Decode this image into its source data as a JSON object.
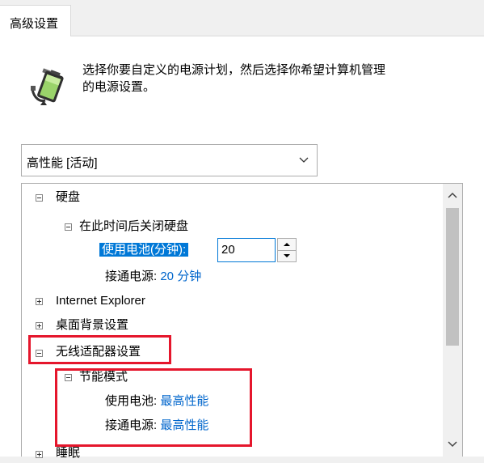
{
  "tab": {
    "label": "高级设置"
  },
  "description": {
    "line1": "选择你要自定义的电源计划，然后选择你希望计算机管理",
    "line2": "的电源设置。"
  },
  "plan_select": {
    "value": "高性能 [活动]"
  },
  "tree": {
    "harddisk": "硬盘",
    "turn_off_disk": "在此时间后关闭硬盘",
    "on_battery_label": "使用电池(分钟):",
    "on_battery_value": "20",
    "plugged_in_label": "接通电源:",
    "plugged_in_value": "20 分钟",
    "ie": "Internet Explorer",
    "desktop_bg": "桌面背景设置",
    "wireless": "无线适配器设置",
    "power_saving": "节能模式",
    "ps_battery_label": "使用电池:",
    "ps_battery_value": "最高性能",
    "ps_plugged_label": "接通电源:",
    "ps_plugged_value": "最高性能",
    "sleep": "睡眠"
  },
  "colors": {
    "highlight_box": "#e5162c",
    "link": "#0066cc",
    "selection": "#0078d7"
  },
  "icons": {
    "power_plan": "battery-plug-icon"
  }
}
